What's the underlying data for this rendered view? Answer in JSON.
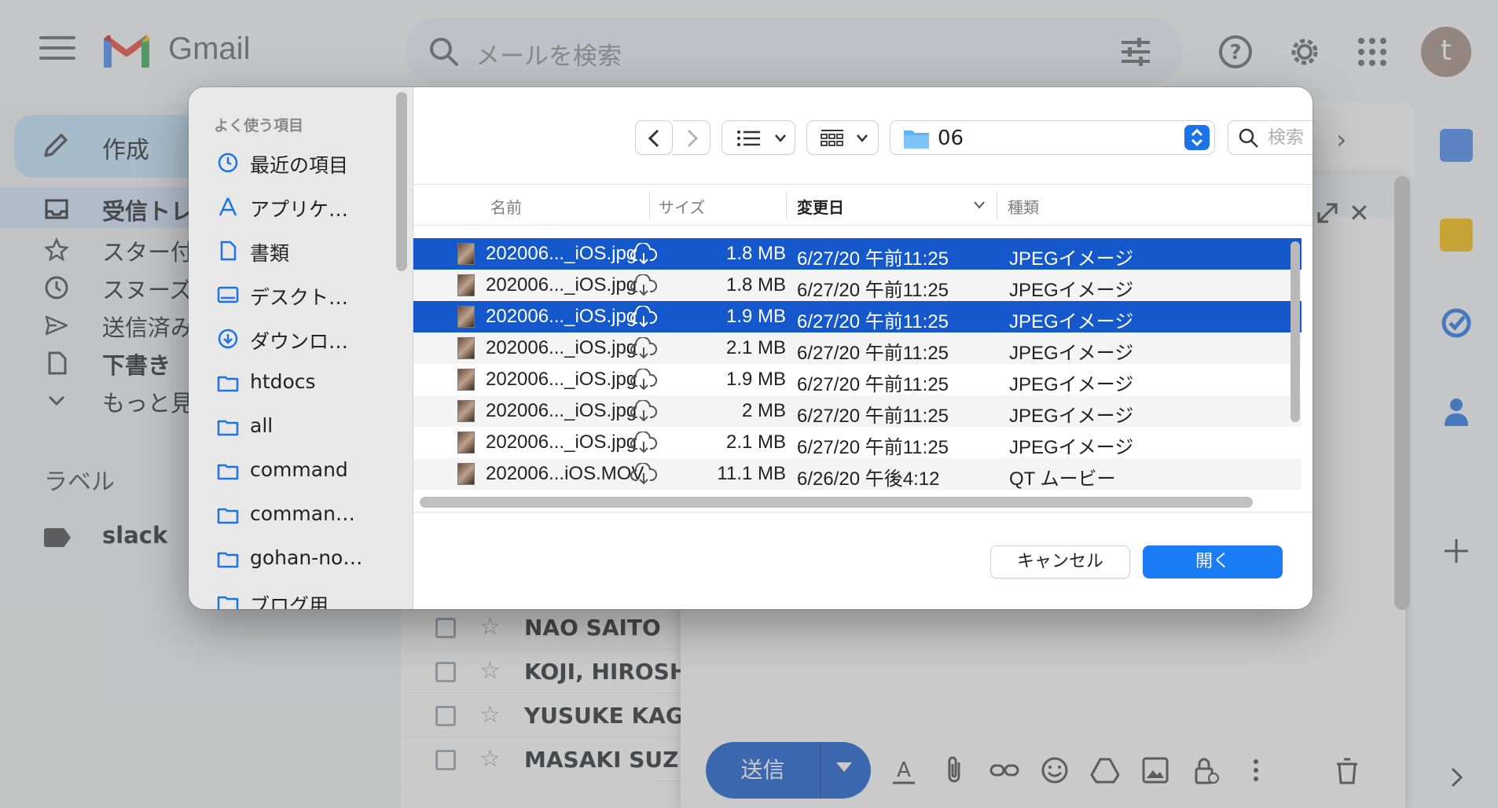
{
  "gmail": {
    "app_name": "Gmail",
    "search_placeholder": "メールを検索",
    "avatar_letter": "t",
    "compose_label": "作成",
    "nav": [
      {
        "label": "受信トレ",
        "bold": true,
        "icon": "inbox-icon"
      },
      {
        "label": "スター付",
        "bold": false,
        "icon": "star-icon"
      },
      {
        "label": "スヌーズ",
        "bold": false,
        "icon": "clock-icon"
      },
      {
        "label": "送信済み",
        "bold": false,
        "icon": "send-icon"
      },
      {
        "label": "下書き",
        "bold": true,
        "icon": "draft-icon"
      },
      {
        "label": "もっと見",
        "bold": false,
        "icon": "chevron-down-icon"
      }
    ],
    "labels_heading": "ラベル",
    "label_items": [
      {
        "label": "slack"
      }
    ],
    "mail_senders": [
      "NAO SAITO",
      "KOJI, HIROSHI",
      "YUSUKE KAGA",
      "MASAKI SUZUK"
    ],
    "compose_send": "送信",
    "colors": {
      "brand_red": "#ea4335",
      "compose_bg": "#c2e7ff",
      "send_blue": "#0b57d0"
    }
  },
  "dialog": {
    "sidebar_heading": "よく使う項目",
    "sidebar_items": [
      {
        "label": "最近の項目",
        "icon": "clock-icon"
      },
      {
        "label": "アプリケ…",
        "icon": "applications-icon"
      },
      {
        "label": "書類",
        "icon": "document-icon"
      },
      {
        "label": "デスクト…",
        "icon": "desktop-icon"
      },
      {
        "label": "ダウンロ…",
        "icon": "download-icon"
      },
      {
        "label": "htdocs",
        "icon": "folder-icon"
      },
      {
        "label": "all",
        "icon": "folder-icon"
      },
      {
        "label": "command",
        "icon": "folder-icon"
      },
      {
        "label": "comman…",
        "icon": "folder-icon"
      },
      {
        "label": "gohan-no…",
        "icon": "folder-icon"
      },
      {
        "label": "ブログ用…",
        "icon": "folder-icon"
      }
    ],
    "current_folder": "06",
    "search_placeholder": "検索",
    "columns": {
      "name": "名前",
      "size": "サイズ",
      "modified": "変更日",
      "kind": "種類"
    },
    "files": [
      {
        "name": "202006..._iOS.jpg",
        "size": "1.8 MB",
        "date": "6/27/20 午前11:25",
        "kind": "JPEGイメージ",
        "selected": true
      },
      {
        "name": "202006..._iOS.jpg",
        "size": "1.8 MB",
        "date": "6/27/20 午前11:25",
        "kind": "JPEGイメージ",
        "selected": false
      },
      {
        "name": "202006..._iOS.jpg",
        "size": "1.9 MB",
        "date": "6/27/20 午前11:25",
        "kind": "JPEGイメージ",
        "selected": true
      },
      {
        "name": "202006..._iOS.jpg",
        "size": "2.1 MB",
        "date": "6/27/20 午前11:25",
        "kind": "JPEGイメージ",
        "selected": false
      },
      {
        "name": "202006..._iOS.jpg",
        "size": "1.9 MB",
        "date": "6/27/20 午前11:25",
        "kind": "JPEGイメージ",
        "selected": false
      },
      {
        "name": "202006..._iOS.jpg",
        "size": "2 MB",
        "date": "6/27/20 午前11:25",
        "kind": "JPEGイメージ",
        "selected": false
      },
      {
        "name": "202006..._iOS.jpg",
        "size": "2.1 MB",
        "date": "6/27/20 午前11:25",
        "kind": "JPEGイメージ",
        "selected": false
      },
      {
        "name": "202006...iOS.MOV",
        "size": "11.1 MB",
        "date": "6/26/20 午後4:12",
        "kind": "QT ムービー",
        "selected": false
      }
    ],
    "cancel_label": "キャンセル",
    "open_label": "開く",
    "colors": {
      "selection": "#1458cc",
      "open_button": "#1a7cf5"
    }
  }
}
